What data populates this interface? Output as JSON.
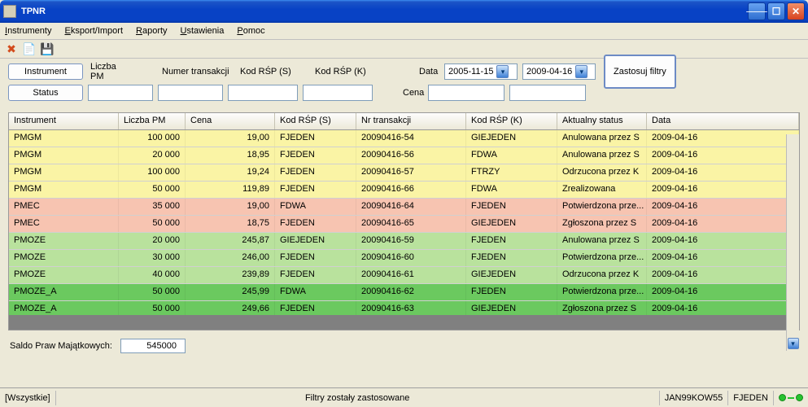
{
  "window": {
    "title": "TPNR"
  },
  "menu": {
    "instrumenty": "Instrumenty",
    "eksport": "Eksport/Import",
    "raporty": "Raporty",
    "ustawienia": "Ustawienia",
    "pomoc": "Pomoc"
  },
  "toolbar_icons": {
    "delete": "✖",
    "new": "📄",
    "save": "💾"
  },
  "filters": {
    "instrument_btn": "Instrument",
    "status_btn": "Status",
    "liczba_pm_lbl": "Liczba PM",
    "numer_transakcji_lbl": "Numer transakcji",
    "kod_rsp_s_lbl": "Kod RŚP (S)",
    "kod_rsp_k_lbl": "Kod RŚP (K)",
    "data_lbl": "Data",
    "cena_lbl": "Cena",
    "date_from": "2005-11-15",
    "date_to": "2009-04-16",
    "apply_btn": "Zastosuj filtry"
  },
  "columns": {
    "instrument": "Instrument",
    "liczba_pm": "Liczba PM",
    "cena": "Cena",
    "kod_rsp_s": "Kod RŚP (S)",
    "nr_transakcji": "Nr transakcji",
    "kod_rsp_k": "Kod RŚP (K)",
    "status": "Aktualny status",
    "data": "Data"
  },
  "rows": [
    {
      "color": "yellow",
      "instrument": "PMGM",
      "lpm": "100 000",
      "cena": "19,00",
      "rsps": "FJEDEN",
      "ntr": "20090416-54",
      "rspk": "GIEJEDEN",
      "status": "Anulowana przez S",
      "data": "2009-04-16"
    },
    {
      "color": "yellow",
      "instrument": "PMGM",
      "lpm": "20 000",
      "cena": "18,95",
      "rsps": "FJEDEN",
      "ntr": "20090416-56",
      "rspk": "FDWA",
      "status": "Anulowana przez S",
      "data": "2009-04-16"
    },
    {
      "color": "yellow",
      "instrument": "PMGM",
      "lpm": "100 000",
      "cena": "19,24",
      "rsps": "FJEDEN",
      "ntr": "20090416-57",
      "rspk": "FTRZY",
      "status": "Odrzucona przez K",
      "data": "2009-04-16"
    },
    {
      "color": "yellow",
      "instrument": "PMGM",
      "lpm": "50 000",
      "cena": "119,89",
      "rsps": "FJEDEN",
      "ntr": "20090416-66",
      "rspk": "FDWA",
      "status": "Zrealizowana",
      "data": "2009-04-16"
    },
    {
      "color": "pink",
      "instrument": "PMEC",
      "lpm": "35 000",
      "cena": "19,00",
      "rsps": "FDWA",
      "ntr": "20090416-64",
      "rspk": "FJEDEN",
      "status": "Potwierdzona prze...",
      "data": "2009-04-16"
    },
    {
      "color": "pink",
      "instrument": "PMEC",
      "lpm": "50 000",
      "cena": "18,75",
      "rsps": "FJEDEN",
      "ntr": "20090416-65",
      "rspk": "GIEJEDEN",
      "status": "Zgłoszona przez S",
      "data": "2009-04-16"
    },
    {
      "color": "lgreen",
      "instrument": "PMOZE",
      "lpm": "20 000",
      "cena": "245,87",
      "rsps": "GIEJEDEN",
      "ntr": "20090416-59",
      "rspk": "FJEDEN",
      "status": "Anulowana przez S",
      "data": "2009-04-16"
    },
    {
      "color": "lgreen",
      "instrument": "PMOZE",
      "lpm": "30 000",
      "cena": "246,00",
      "rsps": "FJEDEN",
      "ntr": "20090416-60",
      "rspk": "FJEDEN",
      "status": "Potwierdzona prze...",
      "data": "2009-04-16"
    },
    {
      "color": "lgreen",
      "instrument": "PMOZE",
      "lpm": "40 000",
      "cena": "239,89",
      "rsps": "FJEDEN",
      "ntr": "20090416-61",
      "rspk": "GIEJEDEN",
      "status": "Odrzucona przez K",
      "data": "2009-04-16"
    },
    {
      "color": "green",
      "instrument": "PMOZE_A",
      "lpm": "50 000",
      "cena": "245,99",
      "rsps": "FDWA",
      "ntr": "20090416-62",
      "rspk": "FJEDEN",
      "status": "Potwierdzona prze...",
      "data": "2009-04-16"
    },
    {
      "color": "green",
      "instrument": "PMOZE_A",
      "lpm": "50 000",
      "cena": "249,66",
      "rsps": "FJEDEN",
      "ntr": "20090416-63",
      "rspk": "GIEJEDEN",
      "status": "Zgłoszona przez S",
      "data": "2009-04-16"
    }
  ],
  "balance": {
    "label": "Saldo Praw Majątkowych:",
    "value": "545000"
  },
  "status": {
    "left": "[Wszystkie]",
    "center": "Filtry zostały zastosowane",
    "user": "JAN99KOW55",
    "code": "FJEDEN"
  }
}
